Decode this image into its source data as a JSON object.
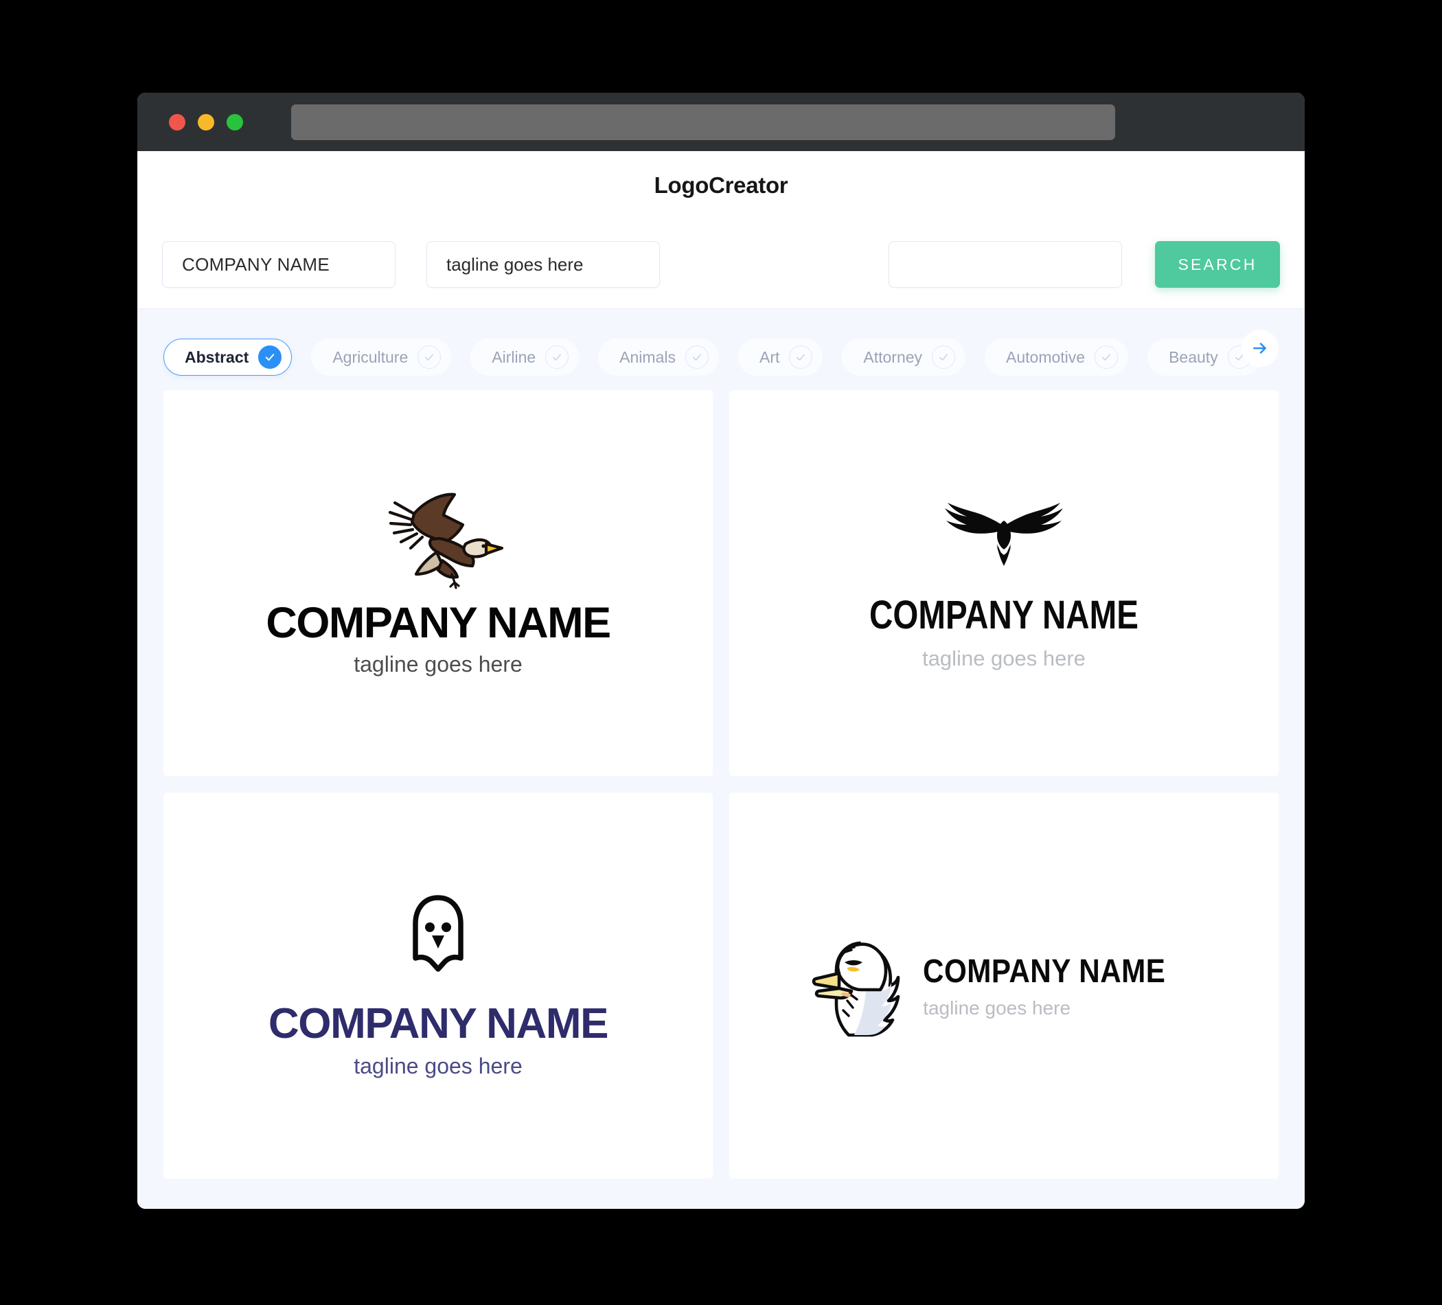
{
  "window": {
    "traffic_lights": [
      {
        "name": "close",
        "color": "#f0564c"
      },
      {
        "name": "minimize",
        "color": "#f8b929"
      },
      {
        "name": "maximize",
        "color": "#28c33d"
      }
    ],
    "address_value": "",
    "address_placeholder": ""
  },
  "header": {
    "title": "LogoCreator"
  },
  "search": {
    "company_value": "COMPANY NAME",
    "company_placeholder": "COMPANY NAME",
    "tagline_value": "tagline goes here",
    "tagline_placeholder": "tagline goes here",
    "extra_value": "",
    "extra_placeholder": "",
    "button_label": "SEARCH",
    "button_color": "#4fc99e"
  },
  "categories": {
    "selected": "Abstract",
    "accent_color": "#2a90f5",
    "next_icon": "arrow-right-icon",
    "items": [
      {
        "label": "Abstract",
        "selected": true
      },
      {
        "label": "Agriculture",
        "selected": false
      },
      {
        "label": "Airline",
        "selected": false
      },
      {
        "label": "Animals",
        "selected": false
      },
      {
        "label": "Art",
        "selected": false
      },
      {
        "label": "Attorney",
        "selected": false
      },
      {
        "label": "Automotive",
        "selected": false
      },
      {
        "label": "Beauty",
        "selected": false
      }
    ]
  },
  "results": {
    "cards": [
      {
        "mark": "flying-eagle-brown-icon",
        "layout": "stacked",
        "company_name": "COMPANY NAME",
        "tagline": "tagline goes here",
        "name_color": "#050505",
        "tagline_color": "#4d4d4d"
      },
      {
        "mark": "eagle-silhouette-black-icon",
        "layout": "stacked",
        "company_name": "COMPANY NAME",
        "tagline": "tagline goes here",
        "name_color": "#0a0a0a",
        "tagline_color": "#b9bcc2"
      },
      {
        "mark": "owl-outline-icon",
        "layout": "stacked",
        "company_name": "COMPANY NAME",
        "tagline": "tagline goes here",
        "name_color": "#2e2c6b",
        "tagline_color": "#4b4b86"
      },
      {
        "mark": "eagle-head-mascot-icon",
        "layout": "inline",
        "company_name": "COMPANY NAME",
        "tagline": "tagline goes here",
        "name_color": "#0a0a0a",
        "tagline_color": "#b9bcc2"
      }
    ]
  },
  "theme": {
    "page_background": "#000000",
    "content_background": "#f4f7fe",
    "card_background": "#ffffff",
    "titlebar_background": "#2e3133"
  }
}
